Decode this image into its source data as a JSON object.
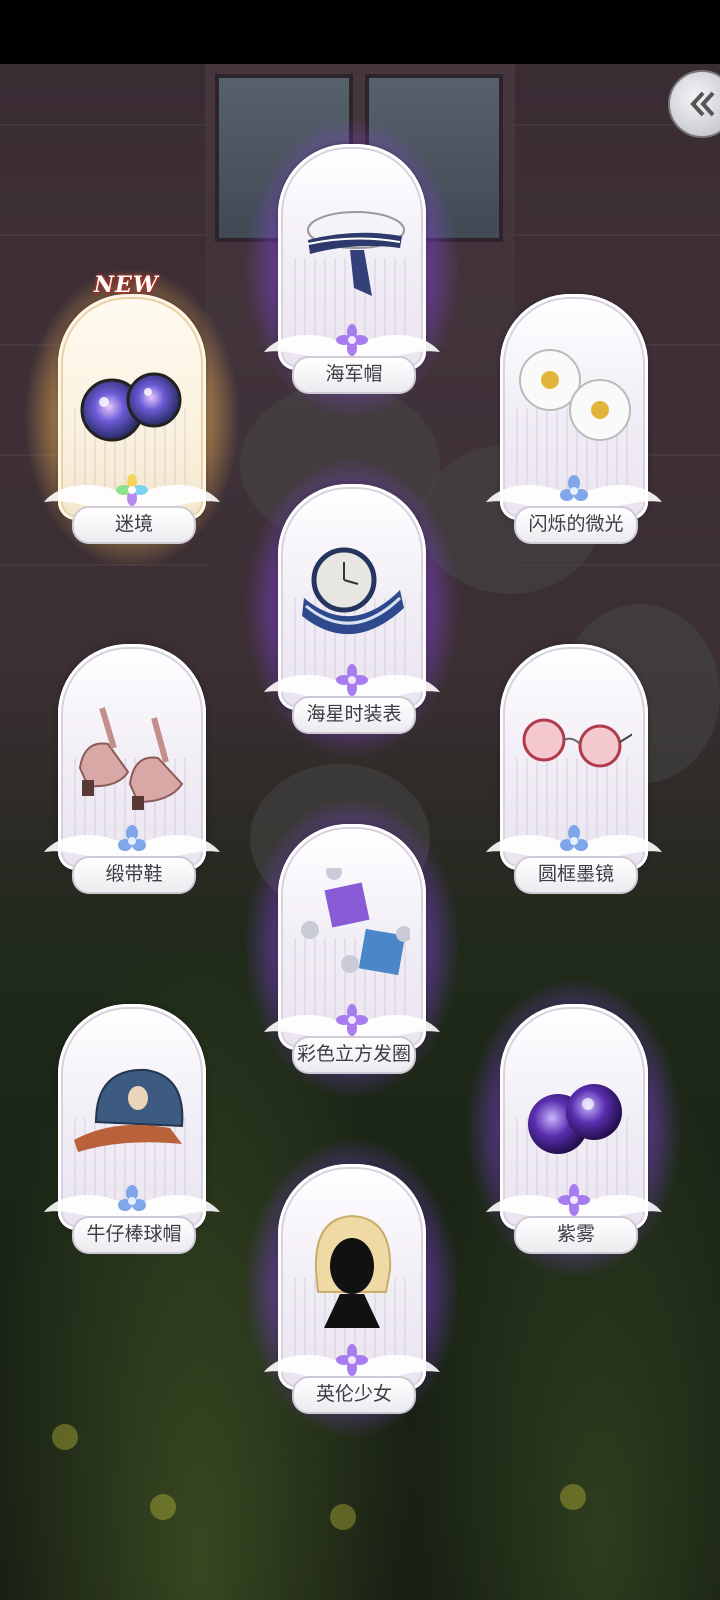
{
  "navigation": {
    "back_icon": "double-chevron-left-icon"
  },
  "colors": {
    "rare_glow": "#9b5cff",
    "new_glow": "#ffd873",
    "card_frame": "#f2eef6",
    "label_text": "#3c3c44"
  },
  "cards": [
    {
      "name": "迷境",
      "rarity": "gold",
      "badge": "NEW",
      "icon": "glitter-contact-lens-icon",
      "gem": "rainbow-flower-gem-icon"
    },
    {
      "name": "海军帽",
      "rarity": "purple",
      "icon": "sailor-beret-icon",
      "gem": "purple-flower-gem-icon"
    },
    {
      "name": "闪烁的微光",
      "rarity": "white",
      "icon": "daisy-earrings-icon",
      "gem": "blue-flower-gem-icon"
    },
    {
      "name": "海星时装表",
      "rarity": "purple",
      "icon": "navy-wristwatch-icon",
      "gem": "purple-flower-gem-icon"
    },
    {
      "name": "缎带鞋",
      "rarity": "white",
      "icon": "ribbon-shoes-icon",
      "gem": "blue-flower-gem-icon"
    },
    {
      "name": "圆框墨镜",
      "rarity": "white",
      "icon": "round-sunglasses-icon",
      "gem": "blue-flower-gem-icon"
    },
    {
      "name": "彩色立方发圈",
      "rarity": "purple",
      "icon": "cube-hair-tie-icon",
      "gem": "purple-flower-gem-icon"
    },
    {
      "name": "牛仔棒球帽",
      "rarity": "white",
      "icon": "denim-baseball-cap-icon",
      "gem": "blue-flower-gem-icon"
    },
    {
      "name": "紫雾",
      "rarity": "purple",
      "icon": "purple-contact-lens-icon",
      "gem": "purple-flower-gem-icon"
    },
    {
      "name": "英伦少女",
      "rarity": "purple",
      "icon": "blonde-bob-hairstyle-icon",
      "gem": "purple-flower-gem-icon"
    }
  ]
}
